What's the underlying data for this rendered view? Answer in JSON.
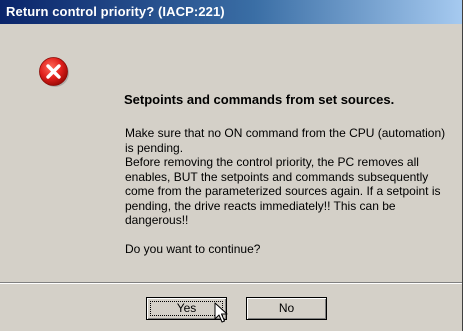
{
  "window": {
    "title": "Return control priority? (IACP:221)"
  },
  "message": {
    "icon": "error-icon",
    "heading": "Setpoints and commands from set sources.",
    "paragraph1": "Make sure that no ON command from the CPU (automation) is pending.",
    "paragraph2": "Before removing the control priority, the PC removes all enables, BUT the setpoints and commands subsequently come from the parameterized sources again. If a setpoint is pending, the drive reacts immediately!! This can be dangerous!!",
    "question": "Do you want to continue?"
  },
  "buttons": {
    "yes_label": "Yes",
    "no_label": "No"
  },
  "colors": {
    "title_gradient_start": "#0a246a",
    "title_gradient_end": "#a6caf0",
    "dialog_background": "#d4d0c8",
    "error_icon_red": "#e0201c"
  }
}
